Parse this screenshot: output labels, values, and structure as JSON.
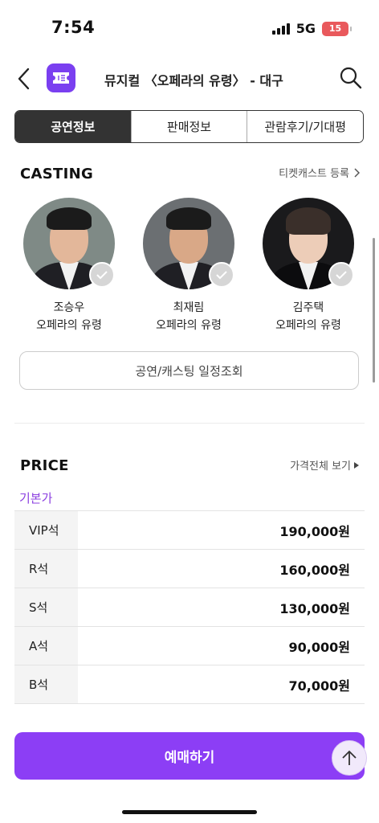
{
  "status_bar": {
    "time": "7:54",
    "network": "5G",
    "battery": "15"
  },
  "header": {
    "title": "뮤지컬 〈오페라의 유령〉 - 대구"
  },
  "tabs": [
    {
      "label": "공연정보",
      "active": true
    },
    {
      "label": "판매정보",
      "active": false
    },
    {
      "label": "관람후기/기대평",
      "active": false
    }
  ],
  "casting": {
    "title": "CASTING",
    "ticketcast_link": "티켓캐스트 등록",
    "cast": [
      {
        "name": "조승우",
        "role": "오페라의 유령"
      },
      {
        "name": "최재림",
        "role": "오페라의 유령"
      },
      {
        "name": "김주택",
        "role": "오페라의 유령"
      }
    ],
    "schedule_button": "공연/캐스팅 일정조회"
  },
  "price": {
    "title": "PRICE",
    "all_link": "가격전체 보기",
    "basic_label": "기본가",
    "rows": [
      {
        "seat": "VIP석",
        "amount": "190,000원"
      },
      {
        "seat": "R석",
        "amount": "160,000원"
      },
      {
        "seat": "S석",
        "amount": "130,000원"
      },
      {
        "seat": "A석",
        "amount": "90,000원"
      },
      {
        "seat": "B석",
        "amount": "70,000원"
      }
    ]
  },
  "reserve_button": "예매하기",
  "colors": {
    "accent": "#8c3ef5",
    "tab_active": "#333333",
    "battery": "#e9595c"
  },
  "icons": [
    "back-icon",
    "ticket-icon",
    "search-icon",
    "check-icon",
    "chevron-right-icon",
    "arrow-up-icon"
  ]
}
